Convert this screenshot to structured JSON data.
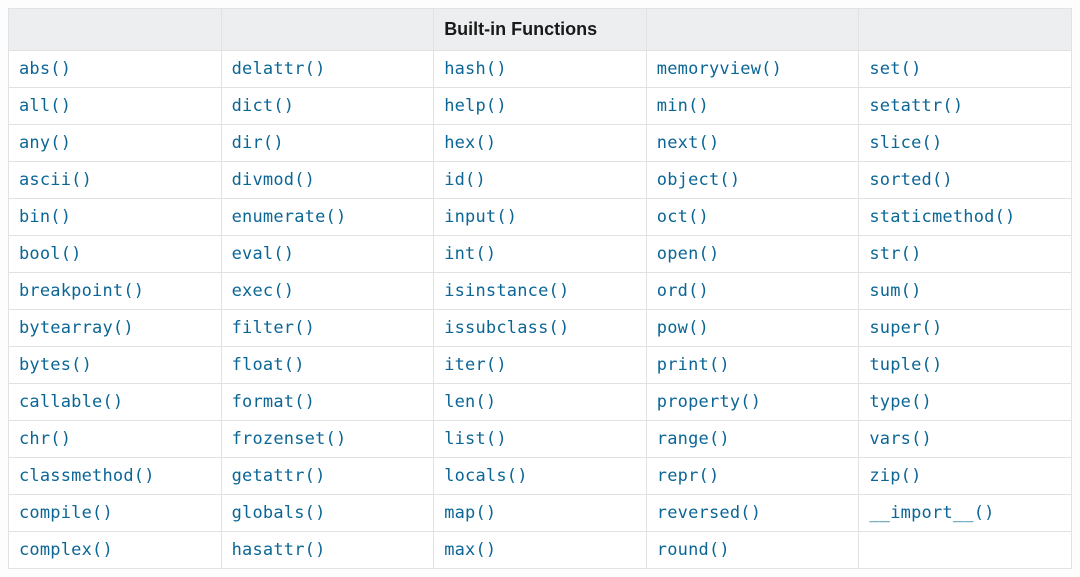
{
  "table": {
    "headers": [
      "",
      "",
      "Built-in Functions",
      "",
      ""
    ],
    "rows": [
      [
        "abs()",
        "delattr()",
        "hash()",
        "memoryview()",
        "set()"
      ],
      [
        "all()",
        "dict()",
        "help()",
        "min()",
        "setattr()"
      ],
      [
        "any()",
        "dir()",
        "hex()",
        "next()",
        "slice()"
      ],
      [
        "ascii()",
        "divmod()",
        "id()",
        "object()",
        "sorted()"
      ],
      [
        "bin()",
        "enumerate()",
        "input()",
        "oct()",
        "staticmethod()"
      ],
      [
        "bool()",
        "eval()",
        "int()",
        "open()",
        "str()"
      ],
      [
        "breakpoint()",
        "exec()",
        "isinstance()",
        "ord()",
        "sum()"
      ],
      [
        "bytearray()",
        "filter()",
        "issubclass()",
        "pow()",
        "super()"
      ],
      [
        "bytes()",
        "float()",
        "iter()",
        "print()",
        "tuple()"
      ],
      [
        "callable()",
        "format()",
        "len()",
        "property()",
        "type()"
      ],
      [
        "chr()",
        "frozenset()",
        "list()",
        "range()",
        "vars()"
      ],
      [
        "classmethod()",
        "getattr()",
        "locals()",
        "repr()",
        "zip()"
      ],
      [
        "compile()",
        "globals()",
        "map()",
        "reversed()",
        "__import__()"
      ],
      [
        "complex()",
        "hasattr()",
        "max()",
        "round()",
        ""
      ]
    ]
  }
}
